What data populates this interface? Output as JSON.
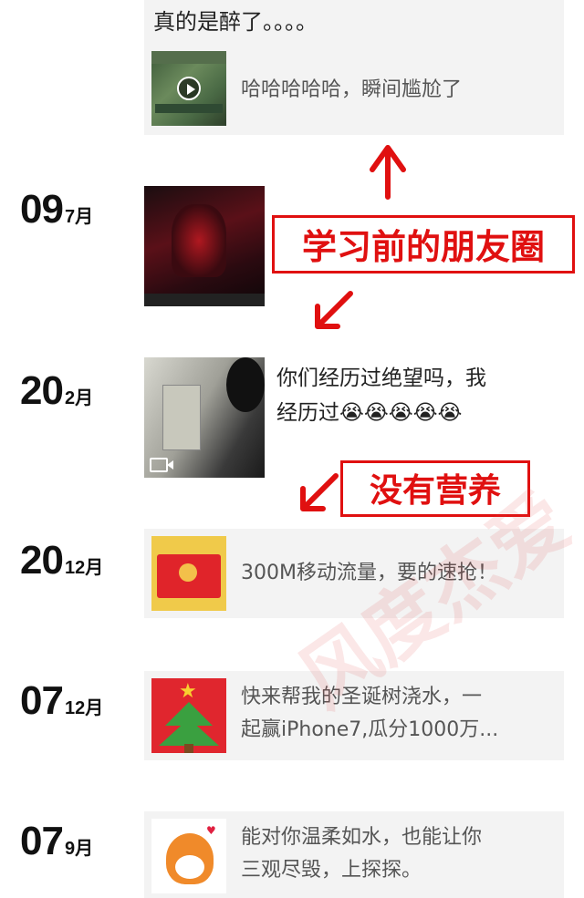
{
  "posts": [
    {
      "text": "真的是醉了。。。。",
      "link_text": "哈哈哈哈哈，瞬间尴尬了"
    },
    {
      "day": "09",
      "month": "7月"
    },
    {
      "day": "20",
      "month": "2月",
      "text_line1": "你们经历过绝望吗，我",
      "text_line2": "经历过😭😭😭😭😭"
    },
    {
      "day": "20",
      "month": "12月",
      "link_text": "300M移动流量，要的速抢！"
    },
    {
      "day": "07",
      "month": "12月",
      "link_text_line1": "快来帮我的圣诞树浇水，一",
      "link_text_line2": "起赢iPhone7,瓜分1000万..."
    },
    {
      "day": "07",
      "month": "9月",
      "link_text_line1": "能对你温柔如水，也能让你",
      "link_text_line2": "三观尽毁，上探探。"
    }
  ],
  "annotations": {
    "label1": "学习前的朋友圈",
    "label2": "没有营养"
  },
  "watermark": "风度杰爱",
  "colors": {
    "annotation_red": "#e01010",
    "card_bg": "#f3f3f3"
  },
  "icons": {
    "play": "play-icon",
    "video": "video-camera-icon"
  }
}
